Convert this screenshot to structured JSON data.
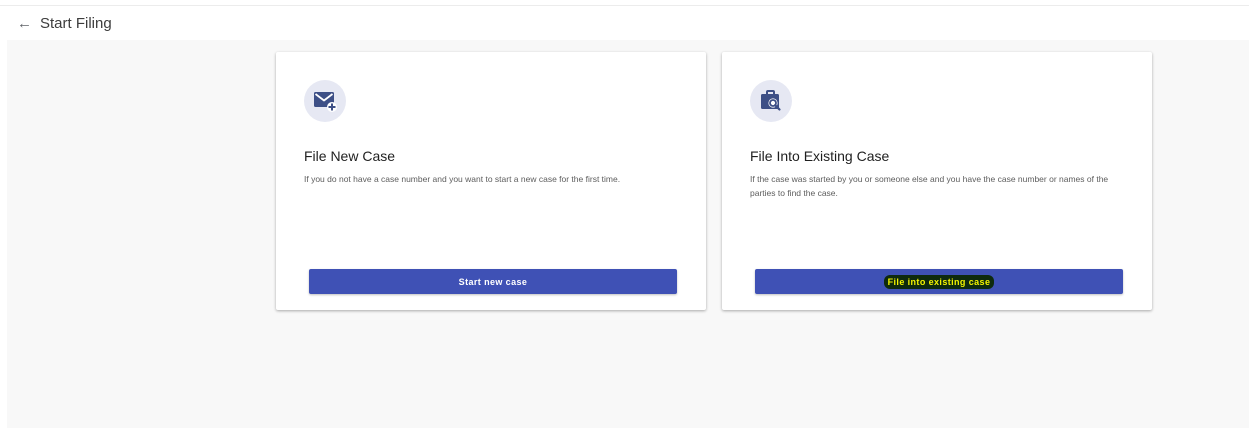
{
  "header": {
    "back_icon": "arrow-left-icon",
    "title": "Start Filing"
  },
  "cards": [
    {
      "icon": "mail-plus-icon",
      "title": "File New Case",
      "description": "If you do not have a case number and you want to start a new case for the first time.",
      "button_label": "Start new case"
    },
    {
      "icon": "briefcase-search-icon",
      "title": "File Into Existing Case",
      "description": "If the case was started by you or someone else and you have the case number or names of the parties to find the case.",
      "button_label": "File into existing case"
    }
  ],
  "colors": {
    "primary": "#3f51b5",
    "icon_fg": "#3d4f86",
    "icon_bg": "#e6e8f3",
    "background": "#f8f8f8"
  }
}
